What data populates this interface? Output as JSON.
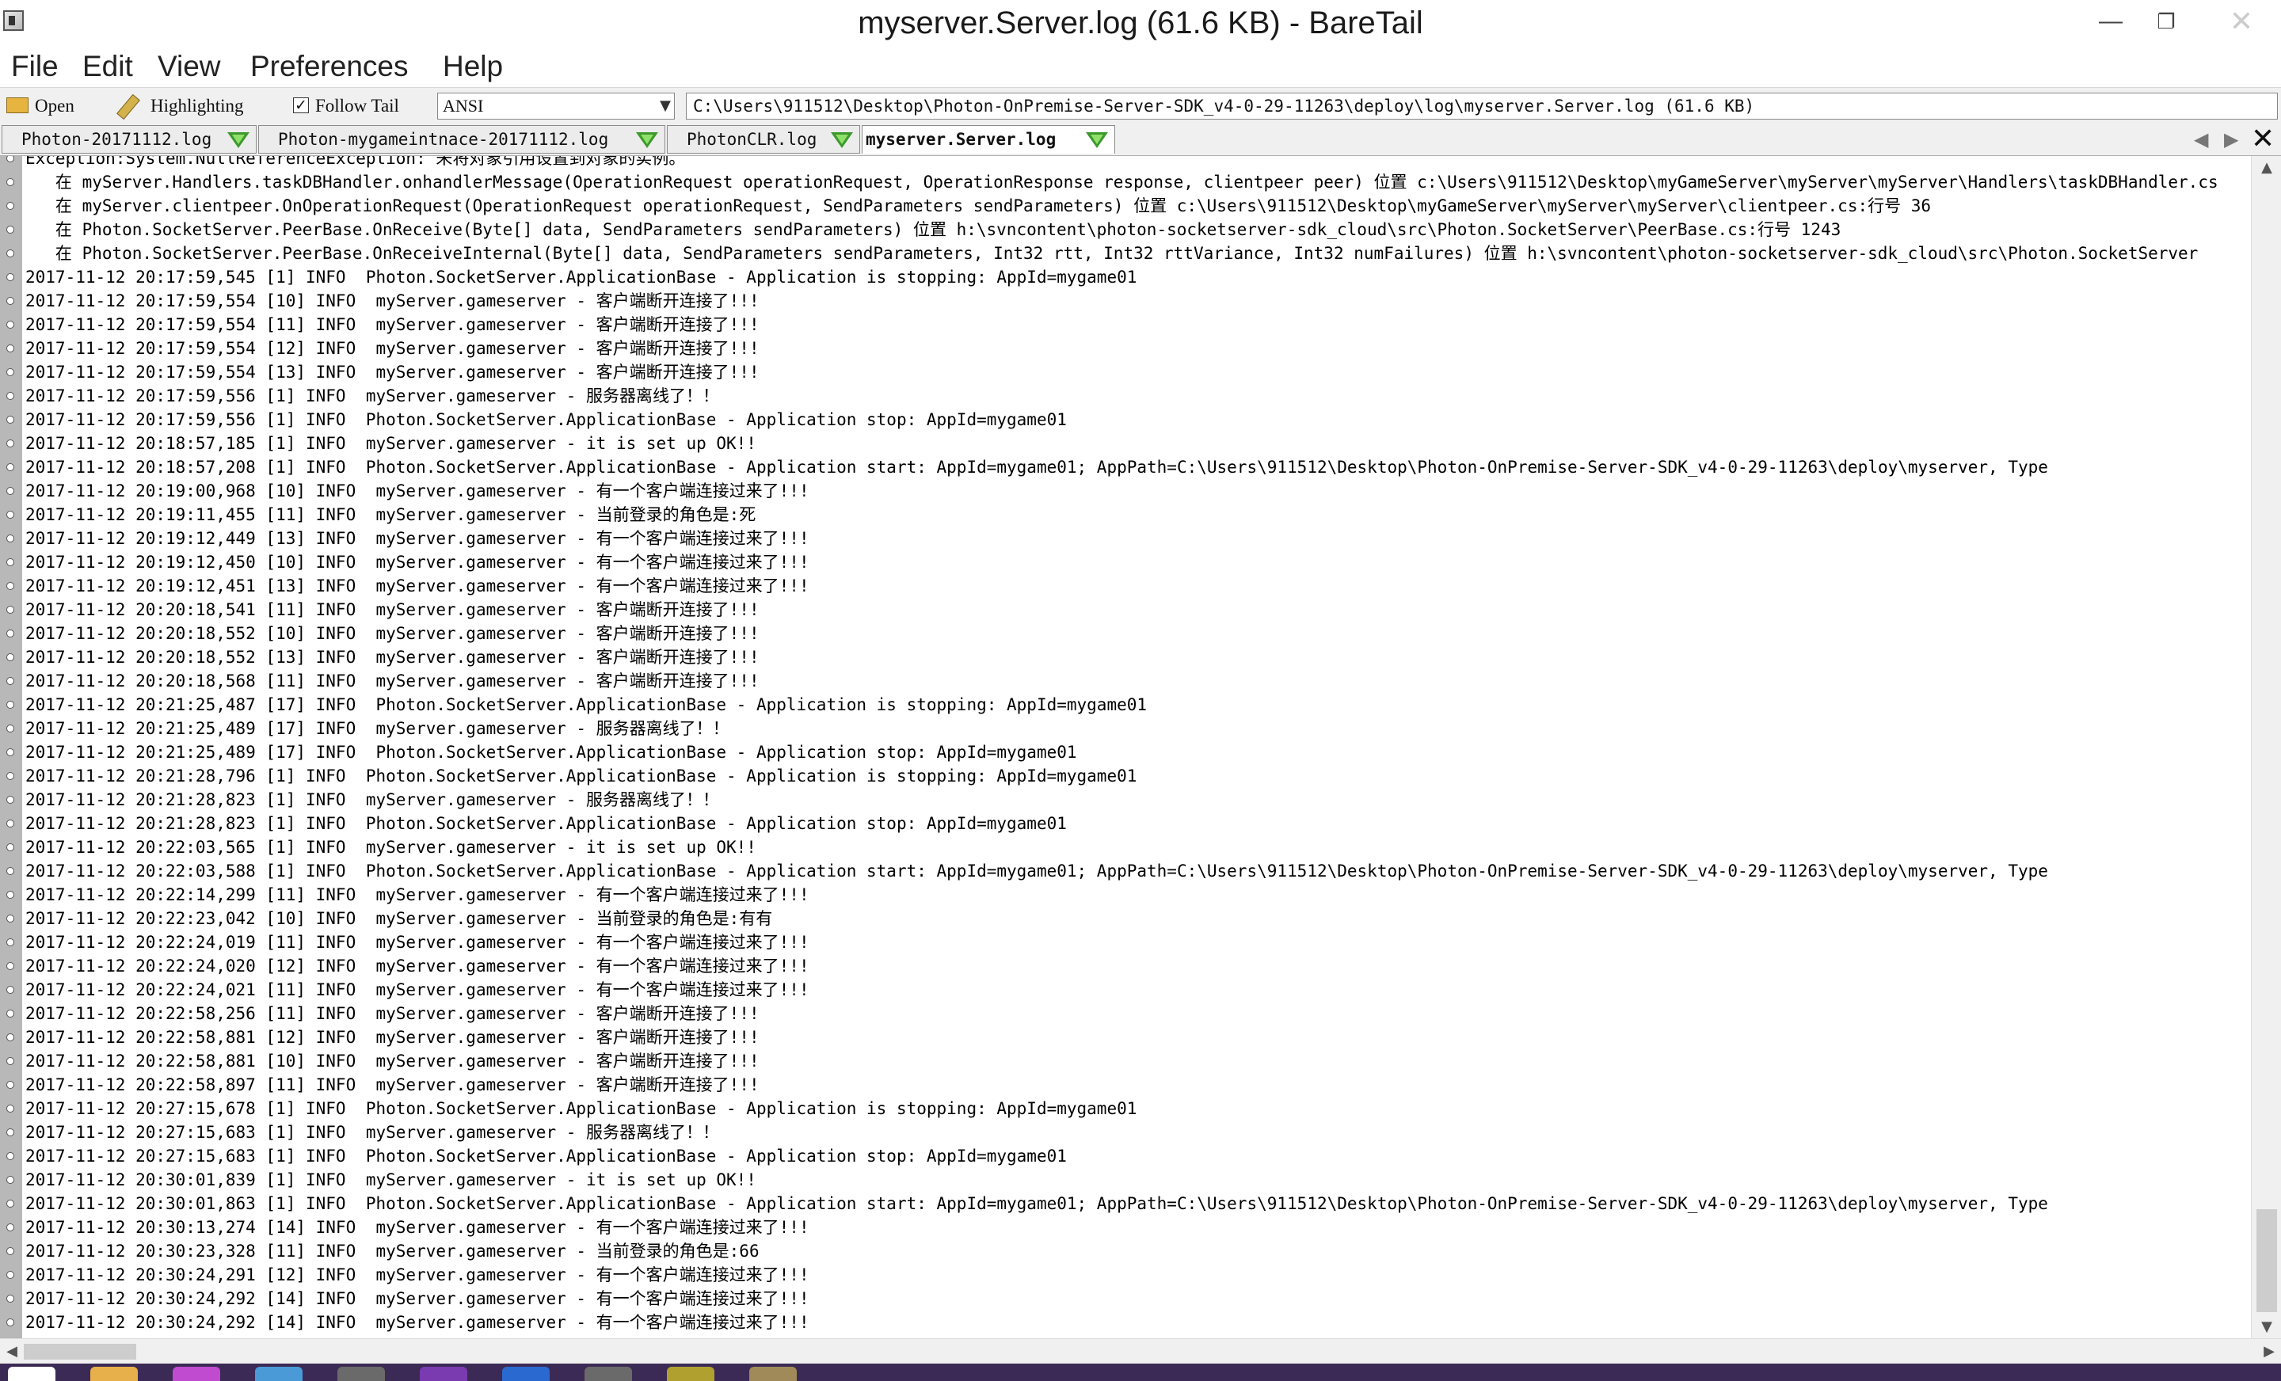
{
  "window": {
    "title": "myserver.Server.log (61.6 KB) - BareTail",
    "controls": {
      "minimize": "—",
      "maximize": "❐",
      "close": "✕"
    }
  },
  "menu": [
    "File",
    "Edit",
    "View",
    "Preferences",
    "Help"
  ],
  "toolbar": {
    "open_label": "Open",
    "highlighting_label": "Highlighting",
    "follow_tail_label": "Follow Tail",
    "follow_tail_checked": true,
    "encoding": "ANSI",
    "file_path": "C:\\Users\\911512\\Desktop\\Photon-OnPremise-Server-SDK_v4-0-29-11263\\deploy\\log\\myserver.Server.log (61.6 KB)"
  },
  "tabs": [
    {
      "label": "Photon-20171112.log",
      "active": false
    },
    {
      "label": "Photon-mygameintnace-20171112.log",
      "active": false
    },
    {
      "label": "PhotonCLR.log",
      "active": false
    },
    {
      "label": "myserver.Server.log",
      "active": true
    }
  ],
  "log_lines": [
    "Exception:System.NullReferenceException: 未将对象引用设置到对象的实例。",
    "   在 myServer.Handlers.taskDBHandler.onhandlerMessage(OperationRequest operationRequest, OperationResponse response, clientpeer peer) 位置 c:\\Users\\911512\\Desktop\\myGameServer\\myServer\\myServer\\Handlers\\taskDBHandler.cs",
    "   在 myServer.clientpeer.OnOperationRequest(OperationRequest operationRequest, SendParameters sendParameters) 位置 c:\\Users\\911512\\Desktop\\myGameServer\\myServer\\myServer\\clientpeer.cs:行号 36",
    "   在 Photon.SocketServer.PeerBase.OnReceive(Byte[] data, SendParameters sendParameters) 位置 h:\\svncontent\\photon-socketserver-sdk_cloud\\src\\Photon.SocketServer\\PeerBase.cs:行号 1243",
    "   在 Photon.SocketServer.PeerBase.OnReceiveInternal(Byte[] data, SendParameters sendParameters, Int32 rtt, Int32 rttVariance, Int32 numFailures) 位置 h:\\svncontent\\photon-socketserver-sdk_cloud\\src\\Photon.SocketServer",
    "2017-11-12 20:17:59,545 [1] INFO  Photon.SocketServer.ApplicationBase - Application is stopping: AppId=mygame01",
    "2017-11-12 20:17:59,554 [10] INFO  myServer.gameserver - 客户端断开连接了!!!",
    "2017-11-12 20:17:59,554 [11] INFO  myServer.gameserver - 客户端断开连接了!!!",
    "2017-11-12 20:17:59,554 [12] INFO  myServer.gameserver - 客户端断开连接了!!!",
    "2017-11-12 20:17:59,554 [13] INFO  myServer.gameserver - 客户端断开连接了!!!",
    "2017-11-12 20:17:59,556 [1] INFO  myServer.gameserver - 服务器离线了！！",
    "2017-11-12 20:17:59,556 [1] INFO  Photon.SocketServer.ApplicationBase - Application stop: AppId=mygame01",
    "2017-11-12 20:18:57,185 [1] INFO  myServer.gameserver - it is set up OK!!",
    "2017-11-12 20:18:57,208 [1] INFO  Photon.SocketServer.ApplicationBase - Application start: AppId=mygame01; AppPath=C:\\Users\\911512\\Desktop\\Photon-OnPremise-Server-SDK_v4-0-29-11263\\deploy\\myserver, Type",
    "2017-11-12 20:19:00,968 [10] INFO  myServer.gameserver - 有一个客户端连接过来了!!!",
    "2017-11-12 20:19:11,455 [11] INFO  myServer.gameserver - 当前登录的角色是:死",
    "2017-11-12 20:19:12,449 [13] INFO  myServer.gameserver - 有一个客户端连接过来了!!!",
    "2017-11-12 20:19:12,450 [10] INFO  myServer.gameserver - 有一个客户端连接过来了!!!",
    "2017-11-12 20:19:12,451 [13] INFO  myServer.gameserver - 有一个客户端连接过来了!!!",
    "2017-11-12 20:20:18,541 [11] INFO  myServer.gameserver - 客户端断开连接了!!!",
    "2017-11-12 20:20:18,552 [10] INFO  myServer.gameserver - 客户端断开连接了!!!",
    "2017-11-12 20:20:18,552 [13] INFO  myServer.gameserver - 客户端断开连接了!!!",
    "2017-11-12 20:20:18,568 [11] INFO  myServer.gameserver - 客户端断开连接了!!!",
    "2017-11-12 20:21:25,487 [17] INFO  Photon.SocketServer.ApplicationBase - Application is stopping: AppId=mygame01",
    "2017-11-12 20:21:25,489 [17] INFO  myServer.gameserver - 服务器离线了！！",
    "2017-11-12 20:21:25,489 [17] INFO  Photon.SocketServer.ApplicationBase - Application stop: AppId=mygame01",
    "2017-11-12 20:21:28,796 [1] INFO  Photon.SocketServer.ApplicationBase - Application is stopping: AppId=mygame01",
    "2017-11-12 20:21:28,823 [1] INFO  myServer.gameserver - 服务器离线了！！",
    "2017-11-12 20:21:28,823 [1] INFO  Photon.SocketServer.ApplicationBase - Application stop: AppId=mygame01",
    "2017-11-12 20:22:03,565 [1] INFO  myServer.gameserver - it is set up OK!!",
    "2017-11-12 20:22:03,588 [1] INFO  Photon.SocketServer.ApplicationBase - Application start: AppId=mygame01; AppPath=C:\\Users\\911512\\Desktop\\Photon-OnPremise-Server-SDK_v4-0-29-11263\\deploy\\myserver, Type",
    "2017-11-12 20:22:14,299 [11] INFO  myServer.gameserver - 有一个客户端连接过来了!!!",
    "2017-11-12 20:22:23,042 [10] INFO  myServer.gameserver - 当前登录的角色是:有有",
    "2017-11-12 20:22:24,019 [11] INFO  myServer.gameserver - 有一个客户端连接过来了!!!",
    "2017-11-12 20:22:24,020 [12] INFO  myServer.gameserver - 有一个客户端连接过来了!!!",
    "2017-11-12 20:22:24,021 [11] INFO  myServer.gameserver - 有一个客户端连接过来了!!!",
    "2017-11-12 20:22:58,256 [11] INFO  myServer.gameserver - 客户端断开连接了!!!",
    "2017-11-12 20:22:58,881 [12] INFO  myServer.gameserver - 客户端断开连接了!!!",
    "2017-11-12 20:22:58,881 [10] INFO  myServer.gameserver - 客户端断开连接了!!!",
    "2017-11-12 20:22:58,897 [11] INFO  myServer.gameserver - 客户端断开连接了!!!",
    "2017-11-12 20:27:15,678 [1] INFO  Photon.SocketServer.ApplicationBase - Application is stopping: AppId=mygame01",
    "2017-11-12 20:27:15,683 [1] INFO  myServer.gameserver - 服务器离线了！！",
    "2017-11-12 20:27:15,683 [1] INFO  Photon.SocketServer.ApplicationBase - Application stop: AppId=mygame01",
    "2017-11-12 20:30:01,839 [1] INFO  myServer.gameserver - it is set up OK!!",
    "2017-11-12 20:30:01,863 [1] INFO  Photon.SocketServer.ApplicationBase - Application start: AppId=mygame01; AppPath=C:\\Users\\911512\\Desktop\\Photon-OnPremise-Server-SDK_v4-0-29-11263\\deploy\\myserver, Type",
    "2017-11-12 20:30:13,274 [14] INFO  myServer.gameserver - 有一个客户端连接过来了!!!",
    "2017-11-12 20:30:23,328 [11] INFO  myServer.gameserver - 当前登录的角色是:66",
    "2017-11-12 20:30:24,291 [12] INFO  myServer.gameserver - 有一个客户端连接过来了!!!",
    "2017-11-12 20:30:24,292 [14] INFO  myServer.gameserver - 有一个客户端连接过来了!!!",
    "2017-11-12 20:30:24,292 [14] INFO  myServer.gameserver - 有一个客户端连接过来了!!!"
  ],
  "taskbar_colors": [
    "#ffffff",
    "#e8b04a",
    "#c04ad0",
    "#4a9ad8",
    "#6a6a6a",
    "#7a3ab0",
    "#2a6ad0",
    "#6a6a6a",
    "#b0a030",
    "#a08a5a"
  ]
}
